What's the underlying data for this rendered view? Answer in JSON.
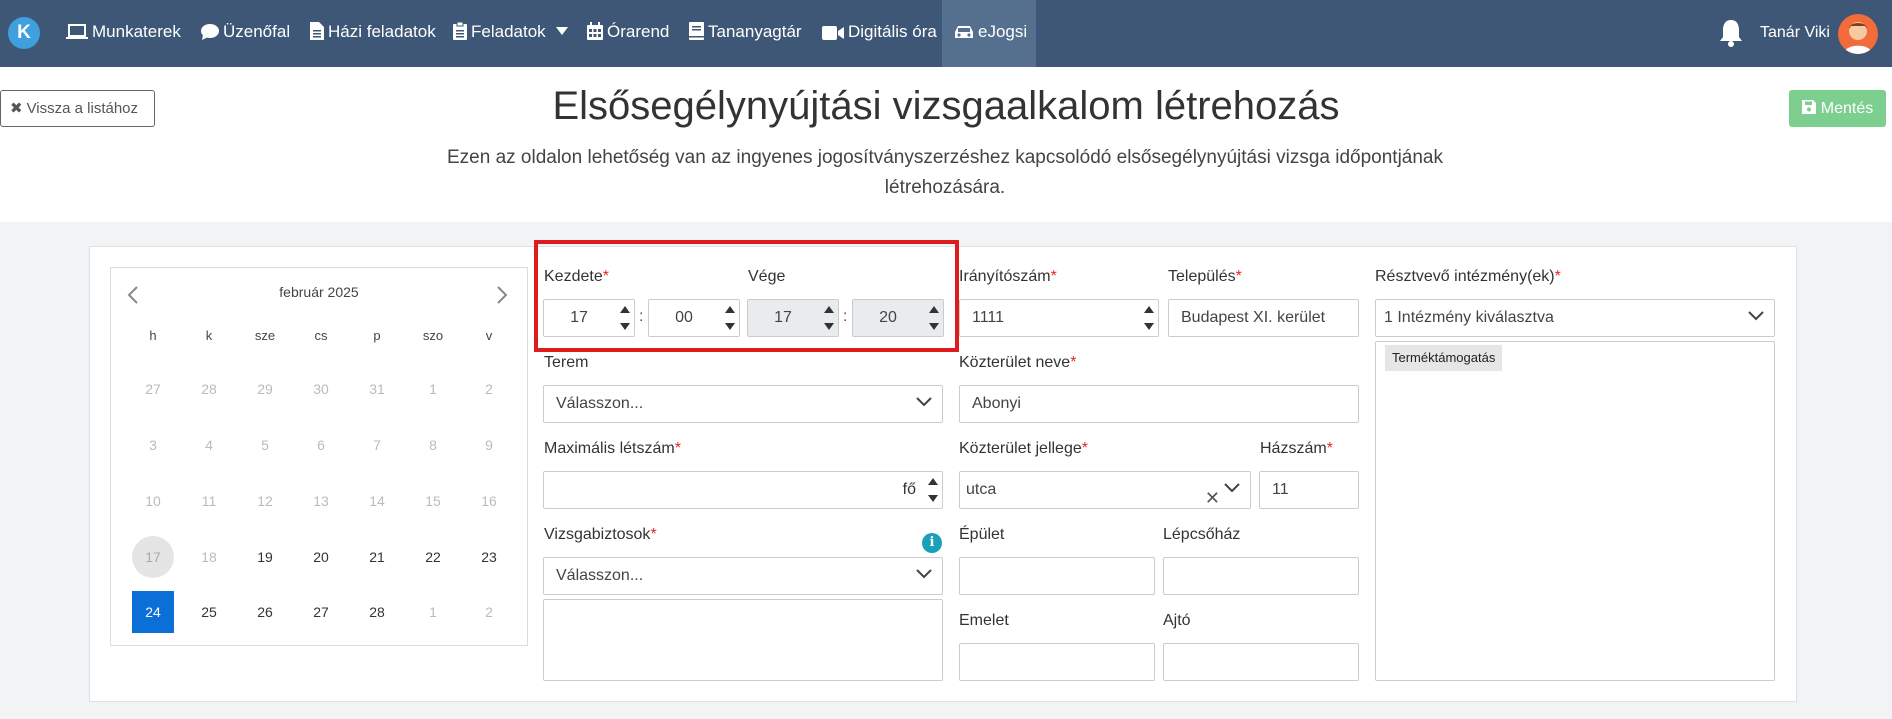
{
  "nav": {
    "logo_letter": "K",
    "items": [
      {
        "label": "Munkaterek",
        "icon": "laptop-icon"
      },
      {
        "label": "Üzenőfal",
        "icon": "chat-icon"
      },
      {
        "label": "Házi feladatok",
        "icon": "file-icon"
      },
      {
        "label": "Feladatok",
        "icon": "clipboard-icon"
      },
      {
        "label": "Órarend",
        "icon": "calendar-icon"
      },
      {
        "label": "Tananyagtár",
        "icon": "book-icon"
      },
      {
        "label": "Digitális óra",
        "icon": "video-icon"
      },
      {
        "label": "eJogsi",
        "icon": "car-icon"
      }
    ],
    "user_name": "Tanár Viki"
  },
  "header": {
    "back_label": "Vissza a listához",
    "title": "Elsősegélynyújtási vizsgaalkalom létrehozás",
    "description": "Ezen az oldalon lehetőség van az ingyenes jogosítványszerzéshez kapcsolódó elsősegélynyújtási vizsga időpontjának létrehozására.",
    "save_label": "Mentés"
  },
  "calendar": {
    "month_label": "február 2025",
    "weekdays": [
      "h",
      "k",
      "sze",
      "cs",
      "p",
      "szo",
      "v"
    ],
    "weeks": [
      [
        "27",
        "28",
        "29",
        "30",
        "31",
        "1",
        "2"
      ],
      [
        "3",
        "4",
        "5",
        "6",
        "7",
        "8",
        "9"
      ],
      [
        "10",
        "11",
        "12",
        "13",
        "14",
        "15",
        "16"
      ],
      [
        "17",
        "18",
        "19",
        "20",
        "21",
        "22",
        "23"
      ],
      [
        "24",
        "25",
        "26",
        "27",
        "28",
        "1",
        "2"
      ]
    ],
    "today": "17",
    "selected": "24"
  },
  "form": {
    "start_label": "Kezdete",
    "start_hour": "17",
    "start_minute": "00",
    "end_label": "Vége",
    "end_hour": "17",
    "end_minute": "20",
    "room_label": "Terem",
    "room_value": "Válasszon...",
    "max_label": "Maximális létszám",
    "max_value": "",
    "max_suffix": "fő",
    "examiners_label": "Vizsgabiztosok",
    "examiners_value": "Válasszon...",
    "zip_label": "Irányítószám",
    "zip_value": "1111",
    "city_label": "Település",
    "city_value": "Budapest XI. kerület",
    "street_label": "Közterület neve",
    "street_value": "Abonyi",
    "street_type_label": "Közterület jellege",
    "street_type_value": "utca",
    "house_label": "Házszám",
    "house_value": "11",
    "building_label": "Épület",
    "stair_label": "Lépcsőház",
    "floor_label": "Emelet",
    "door_label": "Ajtó",
    "institutions_label": "Résztvevő intézmény(ek)",
    "institutions_value": "1 Intézmény kiválasztva",
    "institution_tag": "Terméktámogatás",
    "required_mark": "*",
    "colon": ":"
  },
  "colors": {
    "nav_bg": "#3f5776",
    "accent": "#0a6fd6",
    "save": "#7ccf8e",
    "required": "#e02a2a",
    "highlight": "#e01b1b"
  }
}
